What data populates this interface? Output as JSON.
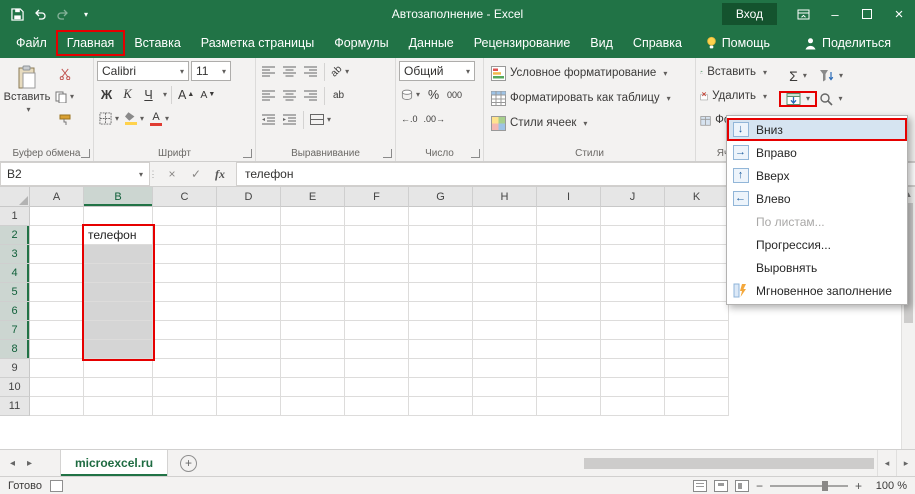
{
  "window": {
    "title": "Автозаполнение - Excel",
    "sign_in": "Вход"
  },
  "ribbon_tabs": [
    {
      "label": "Файл"
    },
    {
      "label": "Главная",
      "active": true,
      "annotated": true
    },
    {
      "label": "Вставка"
    },
    {
      "label": "Разметка страницы"
    },
    {
      "label": "Формулы"
    },
    {
      "label": "Данные"
    },
    {
      "label": "Рецензирование"
    },
    {
      "label": "Вид"
    },
    {
      "label": "Справка"
    },
    {
      "label": "Помощь",
      "icon": "bulb"
    },
    {
      "label": "Поделиться",
      "icon": "person"
    }
  ],
  "ribbon": {
    "clipboard": {
      "group_label": "Буфер обмена",
      "paste_label": "Вставить"
    },
    "font": {
      "group_label": "Шрифт",
      "family": "Calibri",
      "size": "11",
      "bold": "Ж",
      "italic": "К",
      "underline": "Ч",
      "color_letter": "А",
      "grow": "А",
      "shrink": "А"
    },
    "alignment": {
      "group_label": "Выравнивание"
    },
    "number": {
      "group_label": "Число",
      "format": "Общий",
      "percent": "%",
      "thousand": "000",
      "inc_decimal": "←.0",
      "dec_decimal": ".00→"
    },
    "styles": {
      "group_label": "Стили",
      "conditional": "Условное форматирование",
      "format_table": "Форматировать как таблицу",
      "cell_styles": "Стили ячеек"
    },
    "cells": {
      "group_label": "Ячейки",
      "insert": "Вставить",
      "delete": "Удалить",
      "format": "Формат"
    },
    "editing": {
      "sum": "Σ"
    }
  },
  "formula_bar": {
    "name_box": "B2",
    "fx": "fx",
    "value": "телефон"
  },
  "grid": {
    "columns": [
      "A",
      "B",
      "C",
      "D",
      "E",
      "F",
      "G",
      "H",
      "I",
      "J",
      "K"
    ],
    "rows": [
      "1",
      "2",
      "3",
      "4",
      "5",
      "6",
      "7",
      "8",
      "9",
      "10",
      "11"
    ],
    "active_cell": {
      "ref": "B2",
      "value": "телефон"
    },
    "selection": "B2:B8"
  },
  "fill_menu": {
    "items": [
      {
        "label": "Вниз",
        "icon": "arrow-down",
        "highlighted": true
      },
      {
        "label": "Вправо",
        "icon": "arrow-right"
      },
      {
        "label": "Вверх",
        "icon": "arrow-up"
      },
      {
        "label": "Влево",
        "icon": "arrow-left"
      },
      {
        "label": "По листам...",
        "disabled": true
      },
      {
        "label": "Прогрессия..."
      },
      {
        "label": "Выровнять"
      },
      {
        "label": "Мгновенное заполнение",
        "icon": "flash-fill"
      }
    ]
  },
  "sheet_bar": {
    "active_tab": "microexcel.ru"
  },
  "status_bar": {
    "mode": "Готово",
    "zoom": "100 %"
  },
  "colors": {
    "excel_green": "#217346",
    "annotation_red": "#e60000",
    "selection_fill": "#d5d5d5",
    "signin_green": "#14532e"
  }
}
